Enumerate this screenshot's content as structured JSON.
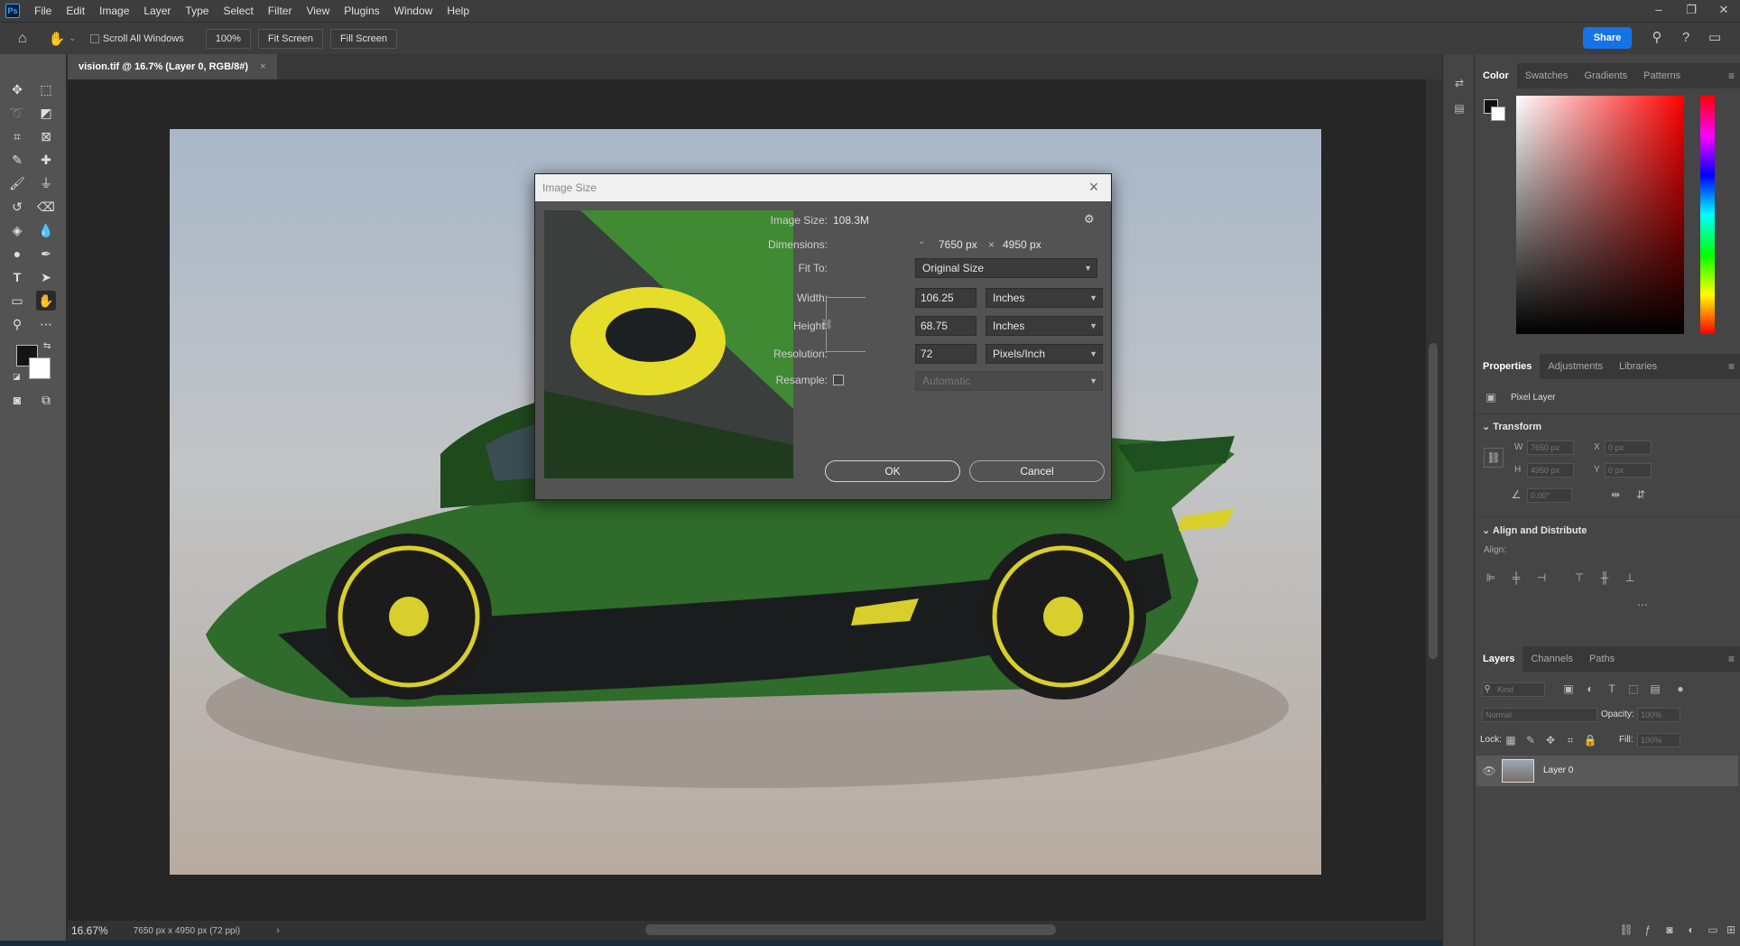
{
  "menubar": {
    "logo": "Ps",
    "items": [
      "File",
      "Edit",
      "Image",
      "Layer",
      "Type",
      "Select",
      "Filter",
      "View",
      "Plugins",
      "Window",
      "Help"
    ]
  },
  "options": {
    "scroll_all_windows": "Scroll All Windows",
    "zoom_btn": "100%",
    "fit_screen": "Fit Screen",
    "fill_screen": "Fill Screen",
    "share": "Share"
  },
  "document": {
    "tab_title": "vision.tif @ 16.7% (Layer 0, RGB/8#)",
    "zoom": "16.67%",
    "doc_info": "7650 px x 4950 px (72 ppi)"
  },
  "dialog": {
    "title": "Image Size",
    "image_size_label": "Image Size:",
    "image_size_value": "108.3M",
    "dimensions_label": "Dimensions:",
    "dim_w": "7650 px",
    "dim_x": "×",
    "dim_h": "4950 px",
    "fit_to_label": "Fit To:",
    "fit_to_value": "Original Size",
    "width_label": "Width:",
    "width_value": "106.25",
    "width_unit": "Inches",
    "height_label": "Height:",
    "height_value": "68.75",
    "height_unit": "Inches",
    "resolution_label": "Resolution:",
    "resolution_value": "72",
    "resolution_unit": "Pixels/Inch",
    "resample_label": "Resample:",
    "resample_value": "Automatic",
    "ok": "OK",
    "cancel": "Cancel"
  },
  "panels": {
    "color_tabs": [
      "Color",
      "Swatches",
      "Gradients",
      "Patterns"
    ],
    "prop_tabs": [
      "Properties",
      "Adjustments",
      "Libraries"
    ],
    "pixel_layer": "Pixel Layer",
    "transform": "Transform",
    "w_label": "W",
    "w_value": "7650 px",
    "h_label": "H",
    "h_value": "4950 px",
    "x_label": "X",
    "x_value": "0 px",
    "y_label": "Y",
    "y_value": "0 px",
    "angle_value": "0.00°",
    "align_distribute": "Align and Distribute",
    "align_label": "Align:",
    "layer_tabs": [
      "Layers",
      "Channels",
      "Paths"
    ],
    "kind_placeholder": "Kind",
    "blend_mode": "Normal",
    "opacity_label": "Opacity:",
    "opacity_value": "100%",
    "lock_label": "Lock:",
    "fill_label": "Fill:",
    "fill_value": "100%",
    "layer_name": "Layer 0"
  },
  "colors": {
    "accent": "#1473e6",
    "car_green": "#2f6b2a",
    "car_yellow": "#d8cf2c"
  }
}
